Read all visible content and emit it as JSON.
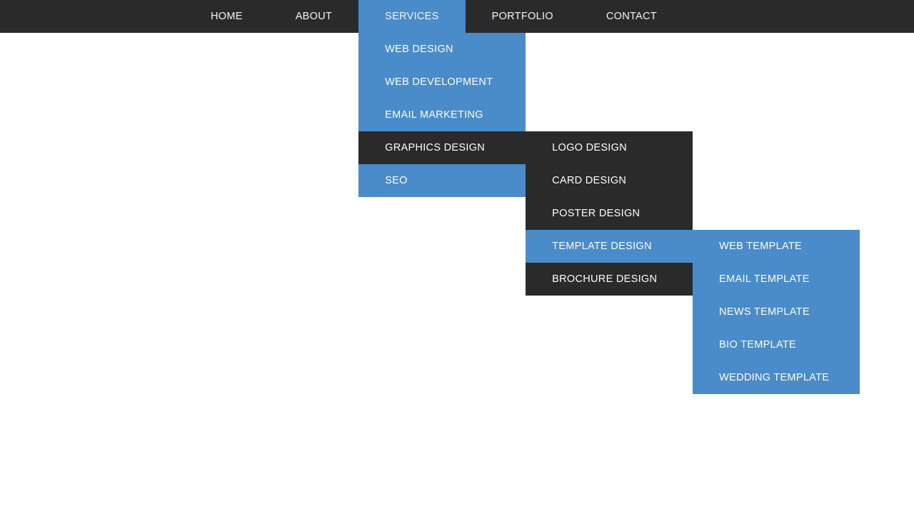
{
  "nav": {
    "items": [
      {
        "label": "HOME"
      },
      {
        "label": "ABOUT"
      },
      {
        "label": "SERVICES"
      },
      {
        "label": "PORTFOLIO"
      },
      {
        "label": "CONTACT"
      }
    ]
  },
  "services": {
    "items": [
      {
        "label": "WEB DESIGN"
      },
      {
        "label": "WEB DEVELOPMENT"
      },
      {
        "label": "EMAIL MARKETING"
      },
      {
        "label": "GRAPHICS DESIGN"
      },
      {
        "label": "SEO"
      }
    ]
  },
  "graphics": {
    "items": [
      {
        "label": "LOGO DESIGN"
      },
      {
        "label": "CARD DESIGN"
      },
      {
        "label": "POSTER DESIGN"
      },
      {
        "label": "TEMPLATE DESIGN"
      },
      {
        "label": "BROCHURE DESIGN"
      }
    ]
  },
  "templates": {
    "items": [
      {
        "label": "WEB TEMPLATE"
      },
      {
        "label": "EMAIL TEMPLATE"
      },
      {
        "label": "NEWS TEMPLATE"
      },
      {
        "label": "BIO TEMPLATE"
      },
      {
        "label": "WEDDING TEMPLATE"
      }
    ]
  }
}
